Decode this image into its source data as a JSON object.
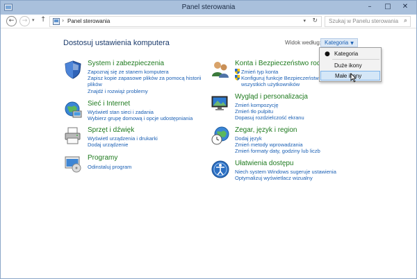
{
  "window": {
    "title": "Panel sterowania",
    "controls": {
      "minimize": "–",
      "maximize": "□",
      "close": "✕"
    }
  },
  "address": {
    "crumb": "Panel sterowania",
    "search_placeholder": "Szukaj w Panelu sterowania"
  },
  "main": {
    "heading": "Dostosuj ustawienia komputera",
    "view_by_label": "Widok według:",
    "view_by_value": "Kategoria"
  },
  "view_menu": {
    "items": [
      "Kategoria",
      "Duże ikony",
      "Małe ikony"
    ],
    "selected": "Kategoria",
    "hovered": "Małe ikony"
  },
  "categories": [
    {
      "title": "System i zabezpieczenia",
      "icon": "shield-icon",
      "links": [
        "Zapoznaj się ze stanem komputera",
        "Zapisz kopie zapasowe plików za pomocą historii",
        "plików",
        "Znajdź i rozwiąż problemy"
      ]
    },
    {
      "title": "Sieć i Internet",
      "icon": "network-globe-icon",
      "links": [
        "Wyświetl stan sieci i zadania",
        "Wybierz grupę domową i opcje udostępniania"
      ]
    },
    {
      "title": "Sprzęt i dźwięk",
      "icon": "printer-icon",
      "links": [
        "Wyświetl urządzenia i drukarki",
        "Dodaj urządzenie"
      ]
    },
    {
      "title": "Programy",
      "icon": "programs-icon",
      "links": [
        "Odinstaluj program"
      ]
    },
    {
      "title": "Konta i Bezpieczeństwo rodzi",
      "icon": "users-icon",
      "links": [
        "Zmień typ konta",
        "Konfiguruj funkcje Bezpieczeństwo",
        "wszystkich użytkowników"
      ]
    },
    {
      "title": "Wygląd i personalizacja",
      "icon": "display-icon",
      "links": [
        "Zmień kompozycję",
        "Zmień tło pulpitu",
        "Dopasuj rozdzielczość ekranu"
      ]
    },
    {
      "title": "Zegar, język i region",
      "icon": "clock-globe-icon",
      "links": [
        "Dodaj język",
        "Zmień metody wprowadzania",
        "Zmień formaty daty, godziny lub liczb"
      ]
    },
    {
      "title": "Ułatwienia dostępu",
      "icon": "accessibility-icon",
      "links": [
        "Niech system Windows sugeruje ustawienia",
        "Optymalizuj wyświetlacz wizualny"
      ]
    }
  ],
  "colors": {
    "titlebar": "#a9c0dc",
    "category_title": "#1e7a1e",
    "link": "#1a5fb4",
    "heading": "#1a3a6b"
  }
}
